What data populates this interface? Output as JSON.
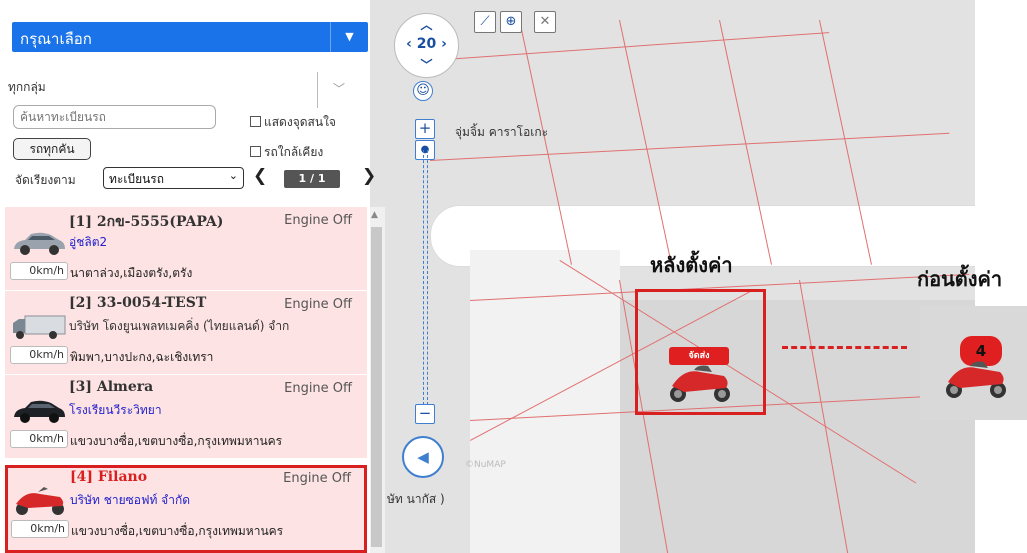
{
  "select_main": {
    "label": "กรุณาเลือก"
  },
  "filters": {
    "group": "ทุกกลุ่ม",
    "search_placeholder": "ค้นหาทะเบียนรถ",
    "show_poi": "แสดงจุดสนใจ",
    "near_car": "รถใกล้เคียง",
    "all_cars_button": "รถทุกคัน",
    "sort_label": "จัดเรียงตาม",
    "sort_value": "ทะเบียนรถ",
    "page": "1 / 1"
  },
  "vehicles": [
    {
      "name": "[1] 2กข-5555(PAPA)",
      "status": "Engine Off",
      "place": "อู่ชลิต2",
      "speed": "0km/h",
      "address": "นาตาล่วง,เมืองตรัง,ตรัง",
      "icon": "car-silver-icon"
    },
    {
      "name": "[2] 33-0054-TEST",
      "status": "Engine Off",
      "place": "บริษัท โดงยูนเพลทเมคคิ่ง (ไทยแลนด์) จำก",
      "speed": "0km/h",
      "address": "พิมพา,บางปะกง,ฉะเชิงเทรา",
      "icon": "truck-icon"
    },
    {
      "name": "[3] Almera",
      "status": "Engine Off",
      "place": "โรงเรียนวีระวิทยา",
      "speed": "0km/h",
      "address": "แขวงบางซื่อ,เขตบางซื่อ,กรุงเทพมหานคร",
      "icon": "car-black-icon"
    },
    {
      "name": "[4] Filano",
      "status": "Engine Off",
      "place": "บริษัท ชายซอฟท์ จำกัด",
      "speed": "0km/h",
      "address": "แขวงบางซื่อ,เขตบางซื่อ,กรุงเทพมหานคร",
      "icon": "scooter-icon"
    }
  ],
  "map": {
    "zoom": "20",
    "poi_label": "จุ่มจิ้ม คาราโอเกะ",
    "road_label": "ษัท นากัส )",
    "watermark": "©NuMAP",
    "after_title": "หลังตั้งค่า",
    "before_title": "ก่อนตั้งค่า",
    "after_tag": "จัดส่ง",
    "before_tag": "4"
  },
  "colors": {
    "accent": "#1a73e8",
    "highlight": "#d92020",
    "row_bg": "#fde3e3"
  }
}
